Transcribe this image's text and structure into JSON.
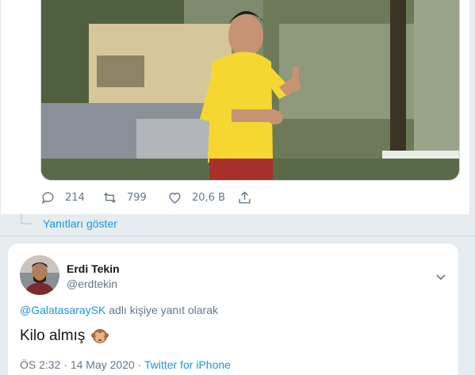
{
  "tweet_previous": {
    "stats": {
      "replies": "214",
      "retweets": "799",
      "likes": "20,6 B"
    },
    "show_replies_label": "Yanıtları göster",
    "media_alt": "photo-football-player-thumbs-up"
  },
  "tweet_reply": {
    "author_name": "Erdi Tekin",
    "author_handle": "@erdtekin",
    "reply_to_mention": "@GalatasaraySK",
    "reply_context_suffix": " adlı kişiye yanıt olarak",
    "text": "Kilo almış",
    "emoji": "see-no-evil-monkey",
    "time": "ÖS 2:32",
    "date": "14 May 2020",
    "separator": " · ",
    "source": "Twitter for iPhone"
  },
  "colors": {
    "link": "#1b95e0",
    "muted": "#657786",
    "jersey": "#f6d731",
    "shorts": "#a8302b"
  }
}
